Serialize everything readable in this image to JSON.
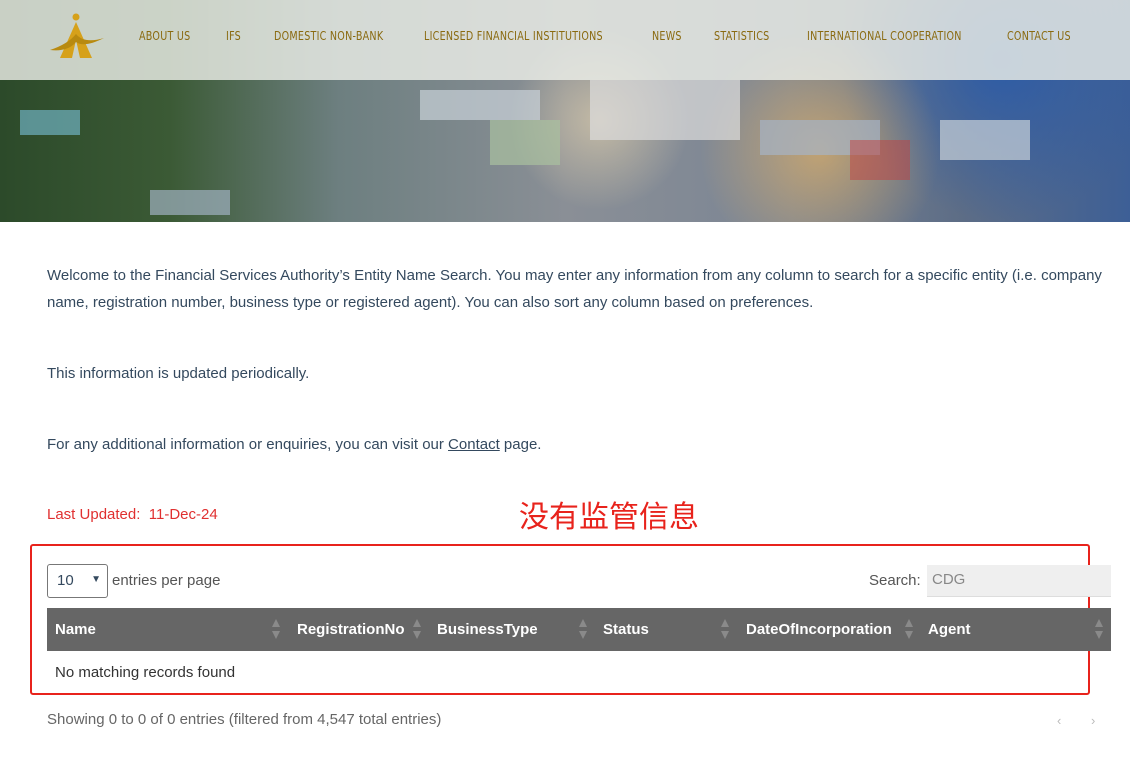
{
  "nav": {
    "items": [
      "ABOUT US",
      "IFS",
      "DOMESTIC NON-BANK",
      "LICENSED FINANCIAL INSTITUTIONS",
      "NEWS",
      "STATISTICS",
      "INTERNATIONAL COOPERATION",
      "CONTACT US"
    ]
  },
  "intro": {
    "welcome": "Welcome to the Financial Services Authority’s Entity Name Search. You may enter any information from any column to search for a specific entity (i.e. company name, registration number, business type or registered agent). You can also sort any column based on preferences.",
    "updated_note": "This information is updated periodically.",
    "contact_prefix": "For any additional information or enquiries, you can visit our ",
    "contact_link": "Contact",
    "contact_suffix": " page."
  },
  "last_updated": {
    "label": "Last Updated:",
    "value": "11-Dec-24"
  },
  "annotation": "没有监管信息",
  "table": {
    "page_size": "10",
    "entries_label": "entries per page",
    "search_label": "Search:",
    "search_value": "CDG",
    "columns": [
      "Name",
      "RegistrationNo",
      "BusinessType",
      "Status",
      "DateOfIncorporation",
      "Agent"
    ],
    "empty": "No matching records found",
    "info": "Showing 0 to 0 of 0 entries (filtered from 4,547 total entries)",
    "prev": "‹",
    "next": "›"
  },
  "colors": {
    "accent_gold": "#8a6a10",
    "annotation_red": "#e8231c",
    "header_gray": "#666666"
  }
}
